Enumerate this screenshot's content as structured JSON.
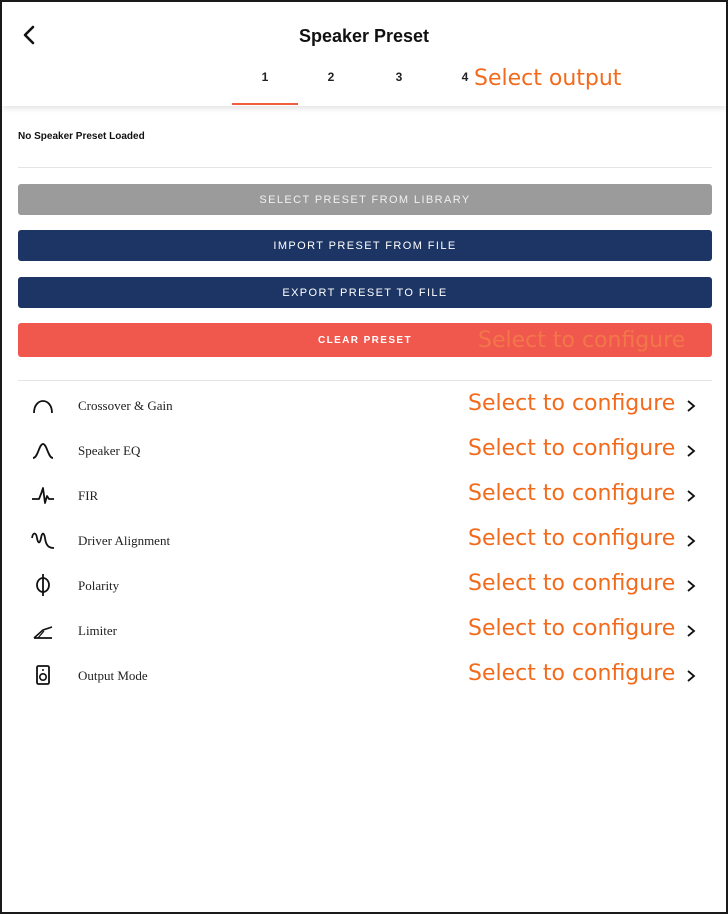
{
  "header": {
    "title": "Speaker Preset",
    "tabs": [
      {
        "label": "1"
      },
      {
        "label": "2"
      },
      {
        "label": "3"
      },
      {
        "label": "4"
      }
    ],
    "active_tab": "1",
    "select_output_label": "Select output"
  },
  "status_text": "No Speaker Preset Loaded",
  "buttons": {
    "select_library": "SELECT PRESET FROM LIBRARY",
    "import_file": "IMPORT PRESET FROM FILE",
    "export_file": "EXPORT PRESET TO FILE",
    "clear": "CLEAR PRESET",
    "clear_overlay": "Select to configure"
  },
  "menu": [
    {
      "label": "Crossover & Gain",
      "icon": "crossover-icon",
      "hint": "Select to configure"
    },
    {
      "label": "Speaker EQ",
      "icon": "speaker-eq-icon",
      "hint": "Select to configure"
    },
    {
      "label": "FIR",
      "icon": "fir-icon",
      "hint": "Select to configure"
    },
    {
      "label": "Driver Alignment",
      "icon": "driver-alignment-icon",
      "hint": "Select to configure"
    },
    {
      "label": "Polarity",
      "icon": "polarity-icon",
      "hint": "Select to configure"
    },
    {
      "label": "Limiter",
      "icon": "limiter-icon",
      "hint": "Select to configure"
    },
    {
      "label": "Output Mode",
      "icon": "output-mode-icon",
      "hint": "Select to configure"
    }
  ],
  "colors": {
    "accent_orange": "#f26b1d",
    "navy": "#1c3564",
    "gray_button": "#9b9b9b",
    "red_button": "#f0584d",
    "tab_underline": "#ef5f3f"
  }
}
